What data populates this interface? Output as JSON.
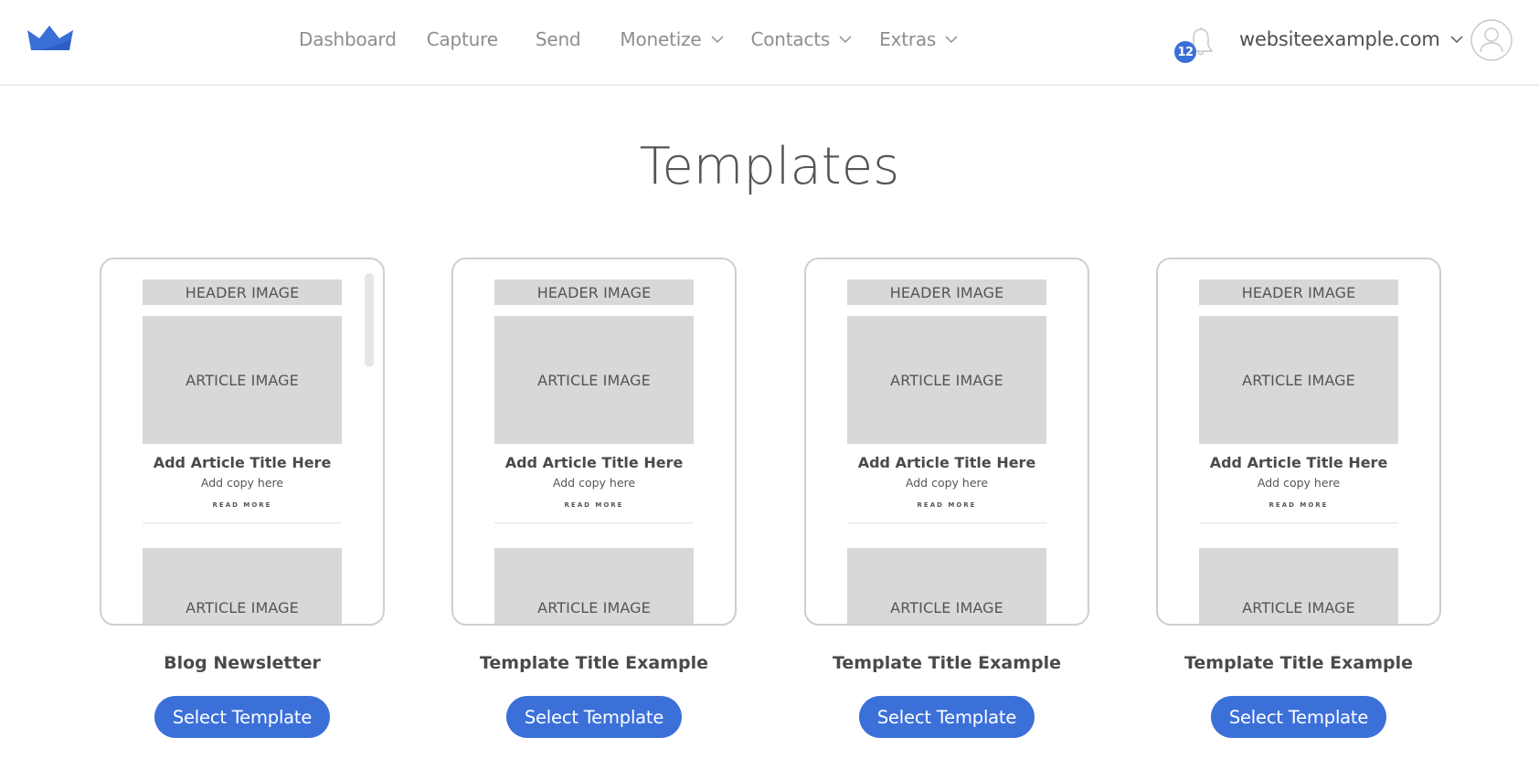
{
  "brand": {
    "logo_icon": "crown-icon",
    "accent_color": "#3a6fd8"
  },
  "nav": {
    "items": [
      {
        "label": "Dashboard",
        "has_dropdown": false
      },
      {
        "label": "Capture",
        "has_dropdown": false
      },
      {
        "label": "Send",
        "has_dropdown": false
      },
      {
        "label": "Monetize",
        "has_dropdown": true
      },
      {
        "label": "Contacts",
        "has_dropdown": true
      },
      {
        "label": "Extras",
        "has_dropdown": true
      }
    ]
  },
  "notifications": {
    "icon": "bell-icon",
    "count": "12"
  },
  "account": {
    "label": "websiteexample.com",
    "avatar_icon": "user-icon"
  },
  "page": {
    "title": "Templates"
  },
  "templates": [
    {
      "name": "Blog Newsletter",
      "button_label": "Select Template",
      "has_scrollbar": true,
      "preview": {
        "header_image": "HEADER IMAGE",
        "article_image": "ARTICLE IMAGE",
        "article_title": "Add Article Title Here",
        "article_copy": "Add copy here",
        "read_more": "READ MORE",
        "article_image_2": "ARTICLE IMAGE"
      }
    },
    {
      "name": "Template Title Example",
      "button_label": "Select Template",
      "has_scrollbar": false,
      "preview": {
        "header_image": "HEADER IMAGE",
        "article_image": "ARTICLE IMAGE",
        "article_title": "Add Article Title Here",
        "article_copy": "Add copy here",
        "read_more": "READ MORE",
        "article_image_2": "ARTICLE IMAGE"
      }
    },
    {
      "name": "Template Title Example",
      "button_label": "Select Template",
      "has_scrollbar": false,
      "preview": {
        "header_image": "HEADER IMAGE",
        "article_image": "ARTICLE IMAGE",
        "article_title": "Add Article Title Here",
        "article_copy": "Add copy here",
        "read_more": "READ MORE",
        "article_image_2": "ARTICLE IMAGE"
      }
    },
    {
      "name": "Template Title Example",
      "button_label": "Select Template",
      "has_scrollbar": false,
      "preview": {
        "header_image": "HEADER IMAGE",
        "article_image": "ARTICLE IMAGE",
        "article_title": "Add Article Title Here",
        "article_copy": "Add copy here",
        "read_more": "READ MORE",
        "article_image_2": "ARTICLE IMAGE"
      }
    }
  ]
}
